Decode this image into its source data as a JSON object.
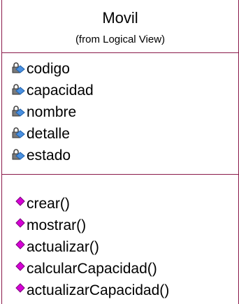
{
  "class": {
    "name": "Movil",
    "stereotype": "(from Logical View)"
  },
  "attributes": [
    {
      "name": "codigo",
      "icon": "private-attribute-icon"
    },
    {
      "name": "capacidad",
      "icon": "private-attribute-icon"
    },
    {
      "name": "nombre",
      "icon": "private-attribute-icon"
    },
    {
      "name": "detalle",
      "icon": "private-attribute-icon"
    },
    {
      "name": "estado",
      "icon": "private-attribute-icon"
    }
  ],
  "operations": [
    {
      "name": "crear()",
      "icon": "public-operation-icon"
    },
    {
      "name": "mostrar()",
      "icon": "public-operation-icon"
    },
    {
      "name": "actualizar()",
      "icon": "public-operation-icon"
    },
    {
      "name": "calcularCapacidad()",
      "icon": "public-operation-icon"
    },
    {
      "name": "actualizarCapacidad()",
      "icon": "public-operation-icon"
    }
  ],
  "colors": {
    "border": "#8a1a4a",
    "operation_icon": "#d600d6",
    "attribute_icon_body": "#4a90e0",
    "lock": "#6a6a6a"
  }
}
